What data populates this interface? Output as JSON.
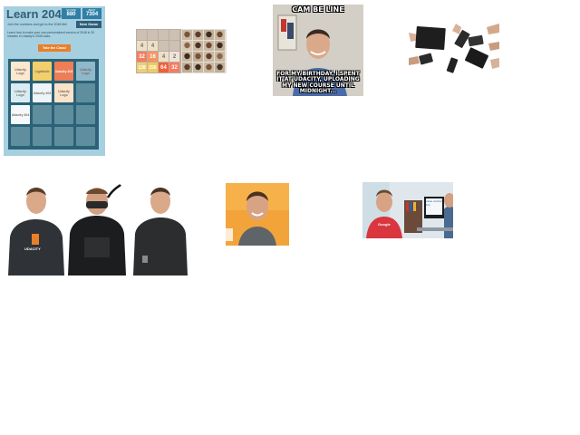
{
  "game": {
    "title": "Learn 2048",
    "score_label": "SCORE",
    "score_value": "880",
    "best_label": "BEST",
    "best_value": "7304",
    "join_text": "Join the numbers and get to the 2048 tile!",
    "new_game": "New Game",
    "desc_text": "Learn how to make your own personalized version of 2048 in 30 minutes in Udacity's 2048 class.",
    "class_button": "Take the Class!",
    "grid": [
      [
        "Udacity Logo",
        "Lightbulb",
        "Udacity 404",
        "Udacity Logo"
      ],
      [
        "Udacity Logo",
        "Udacity 404",
        "Udacity Logo",
        ""
      ],
      [
        "Udacity 404",
        "",
        "",
        ""
      ],
      [
        "",
        "",
        "",
        ""
      ]
    ]
  },
  "mini2048": {
    "numbers": [
      [
        "",
        "",
        "",
        ""
      ],
      [
        "4",
        "4",
        "",
        ""
      ],
      [
        "32",
        "16",
        "4",
        "2"
      ],
      [
        "128",
        "256",
        "64",
        "32"
      ]
    ]
  },
  "meme": {
    "top_text": "CAM BE LINE",
    "bottom_text": "FOR MY BIRTHDAY, I SPENT IT AT UDACITY, UPLOADING MY NEW COURSE UNTIL MIDNIGHT..."
  },
  "trio": {
    "shirt_text": "UDACITY"
  },
  "office": {
    "monitor_text": "value vertical line",
    "shirt_text": "Google"
  },
  "colors": {
    "game_bg": "#9fc8d8",
    "udacity_orange": "#e8802a",
    "grid_bg": "#2b6277"
  }
}
